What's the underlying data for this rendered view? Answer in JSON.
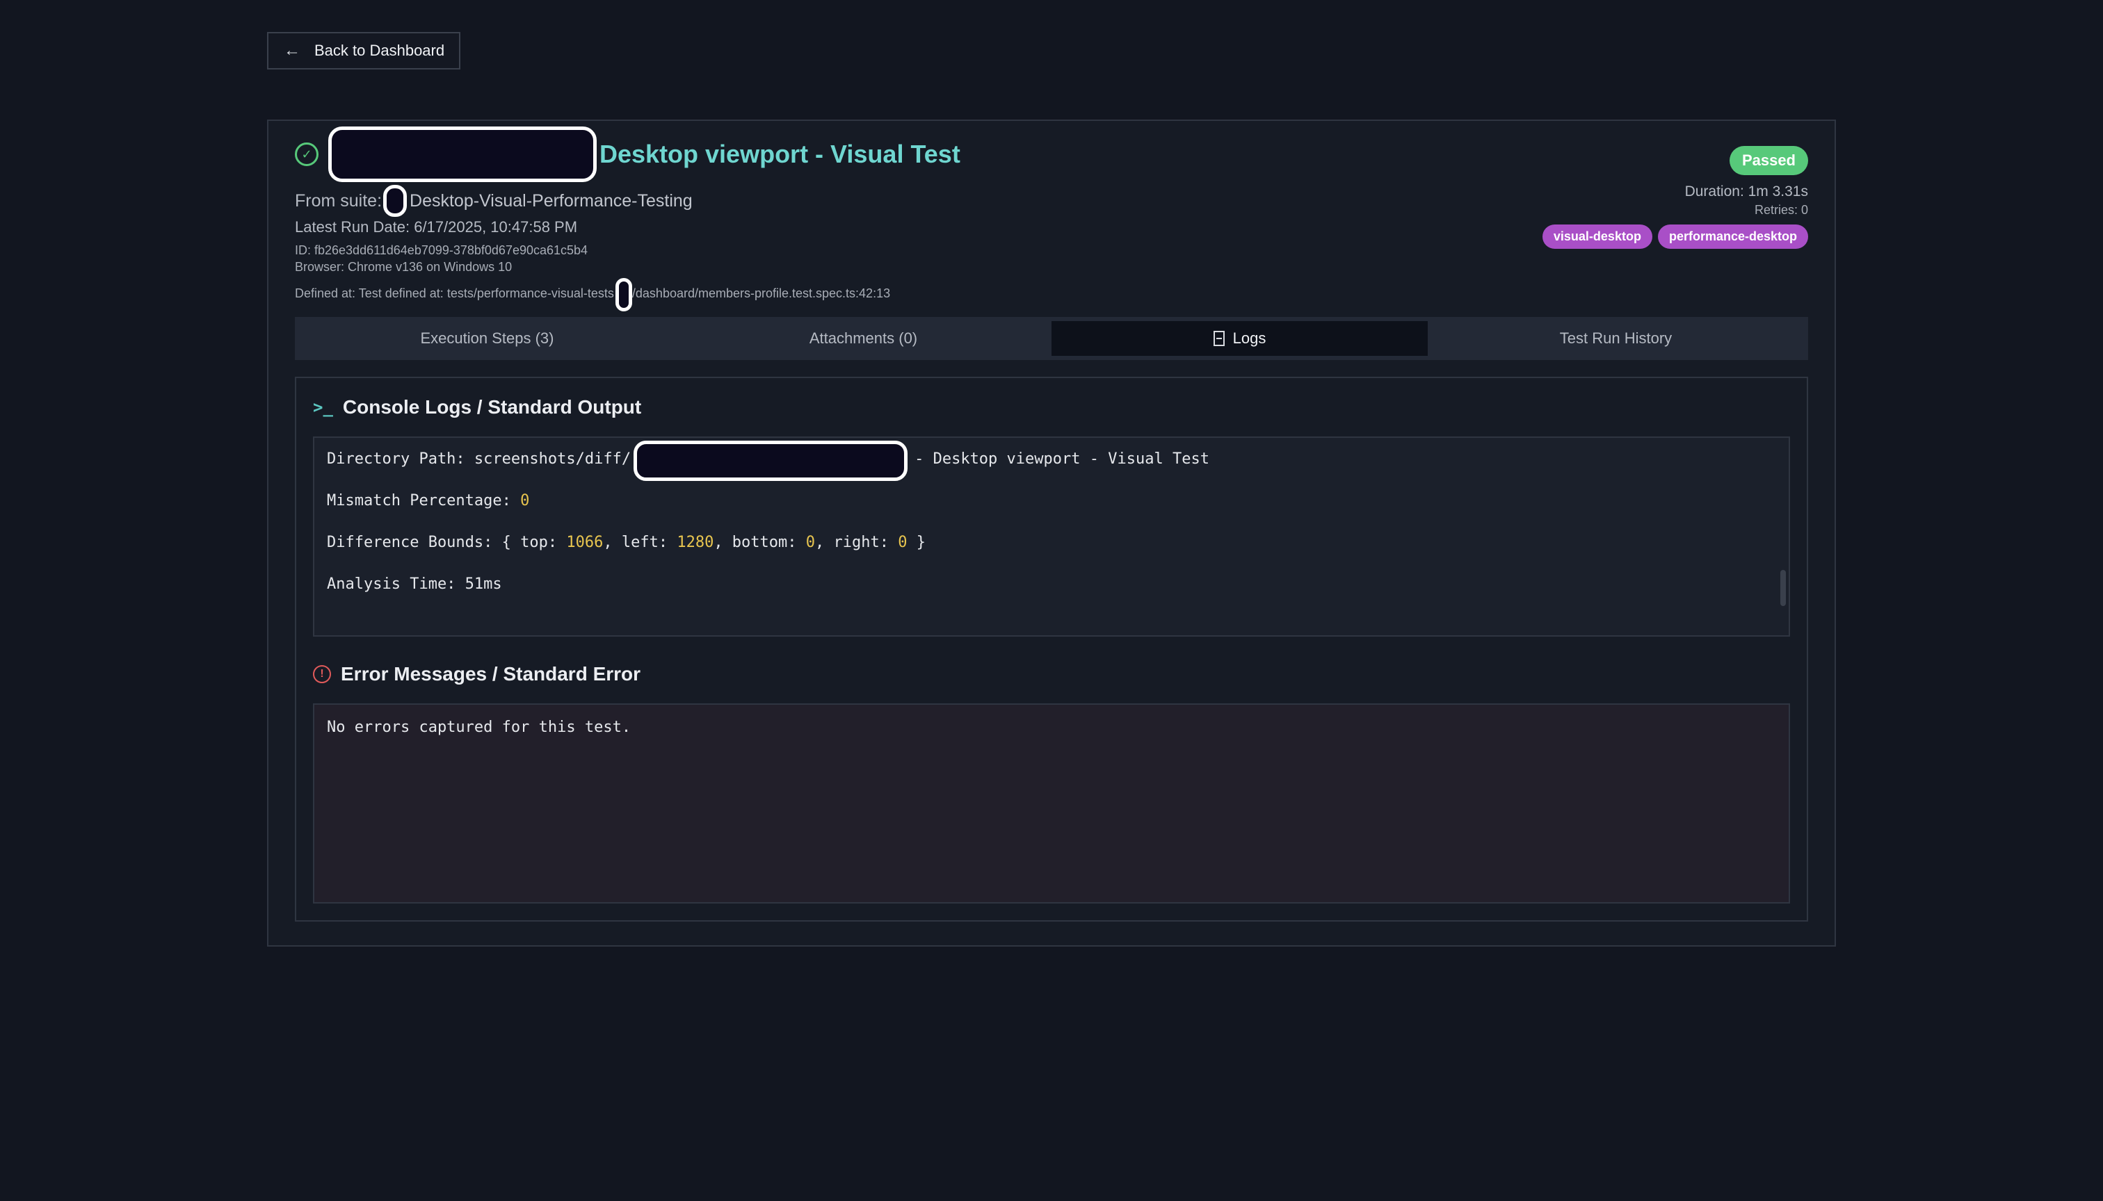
{
  "nav": {
    "back_label": "Back to Dashboard"
  },
  "test": {
    "title": "Desktop viewport - Visual Test",
    "suite_prefix": "From suite:",
    "suite_name": "Desktop-Visual-Performance-Testing",
    "run_date_label": "Latest Run Date: 6/17/2025, 10:47:58 PM",
    "id_line": "ID: fb26e3dd611d64eb7099-378bf0d67e90ca61c5b4",
    "browser_line": "Browser: Chrome v136 on Windows 10",
    "defined_prefix": "Defined at: Test defined at: tests/performance-visual-tests",
    "defined_suffix": "/dashboard/members-profile.test.spec.ts:42:13",
    "status": "Passed",
    "duration": "Duration: 1m 3.31s",
    "retries": "Retries: 0",
    "tags": [
      "visual-desktop",
      "performance-desktop"
    ]
  },
  "tabs": [
    {
      "label": "Execution Steps (3)"
    },
    {
      "label": "Attachments (0)"
    },
    {
      "label": "Logs"
    },
    {
      "label": "Test Run History"
    }
  ],
  "console": {
    "title": "Console Logs / Standard Output",
    "dir_prefix": "Directory Path: screenshots/diff/",
    "dir_suffix": "- Desktop viewport - Visual Test",
    "mismatch_label": "Mismatch Percentage: ",
    "mismatch_value": "0",
    "bounds_prefix": "Difference Bounds: { top: ",
    "bounds_top": "1066",
    "bounds_left_label": ", left: ",
    "bounds_left": "1280",
    "bounds_bottom_label": ", bottom: ",
    "bounds_bottom": "0",
    "bounds_right_label": ", right: ",
    "bounds_right": "0",
    "bounds_close": " }",
    "analysis_time": "Analysis Time: 51ms"
  },
  "errors": {
    "title": "Error Messages / Standard Error",
    "message": "No errors captured for this test."
  },
  "colors": {
    "accent_title": "#6fd6d0",
    "passed": "#57c97a",
    "tag": "#a94fc7",
    "number": "#e8c54f",
    "error_icon": "#e05a5a"
  }
}
